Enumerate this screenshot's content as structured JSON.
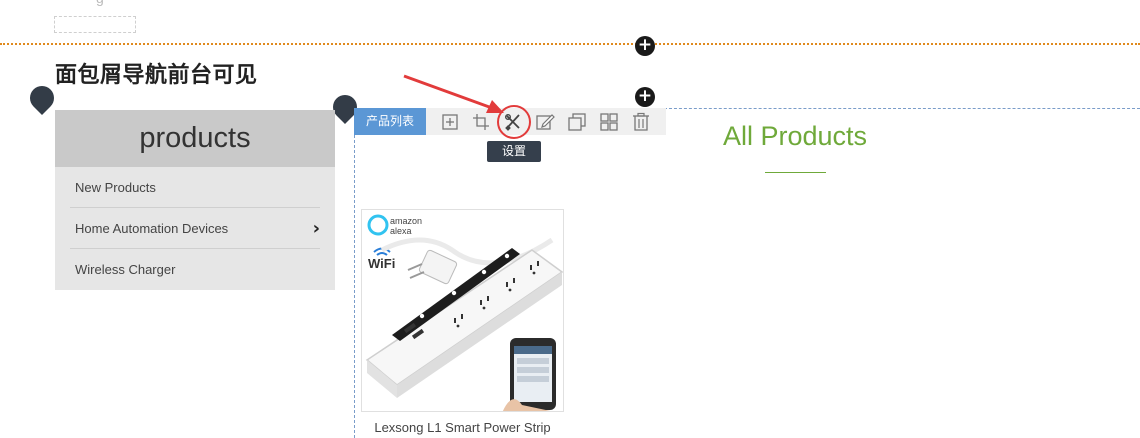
{
  "top": {
    "ghost_text": "g"
  },
  "heading": {
    "text": "面包屑导航前台可见"
  },
  "category_panel": {
    "title": "products",
    "items": [
      {
        "label": "New Products",
        "has_children": false
      },
      {
        "label": "Home Automation Devices",
        "has_children": true,
        "chevron": "›"
      },
      {
        "label": "Wireless Charger",
        "has_children": false
      }
    ]
  },
  "toolbar": {
    "module_label": "产品列表",
    "icons": [
      "add-icon",
      "crop-icon",
      "settings-tools-icon",
      "edit-icon",
      "copy-icon",
      "grid-icon",
      "trash-icon"
    ],
    "tooltip": "设置"
  },
  "plus_buttons": {
    "symbol": "+"
  },
  "product_section": {
    "title": "All Products",
    "accent_color": "#6fa93a",
    "products": [
      {
        "name": "Lexsong L1 Smart Power Strip",
        "image_badges": {
          "brand_line1": "amazon",
          "brand_line2": "alexa",
          "wifi": "WiFi"
        }
      }
    ]
  },
  "colors": {
    "toolbar_label_bg": "#5b97d5",
    "highlight": "#e23b3b",
    "section_divider": "#e08a1e",
    "module_border": "#7a9cc9"
  }
}
